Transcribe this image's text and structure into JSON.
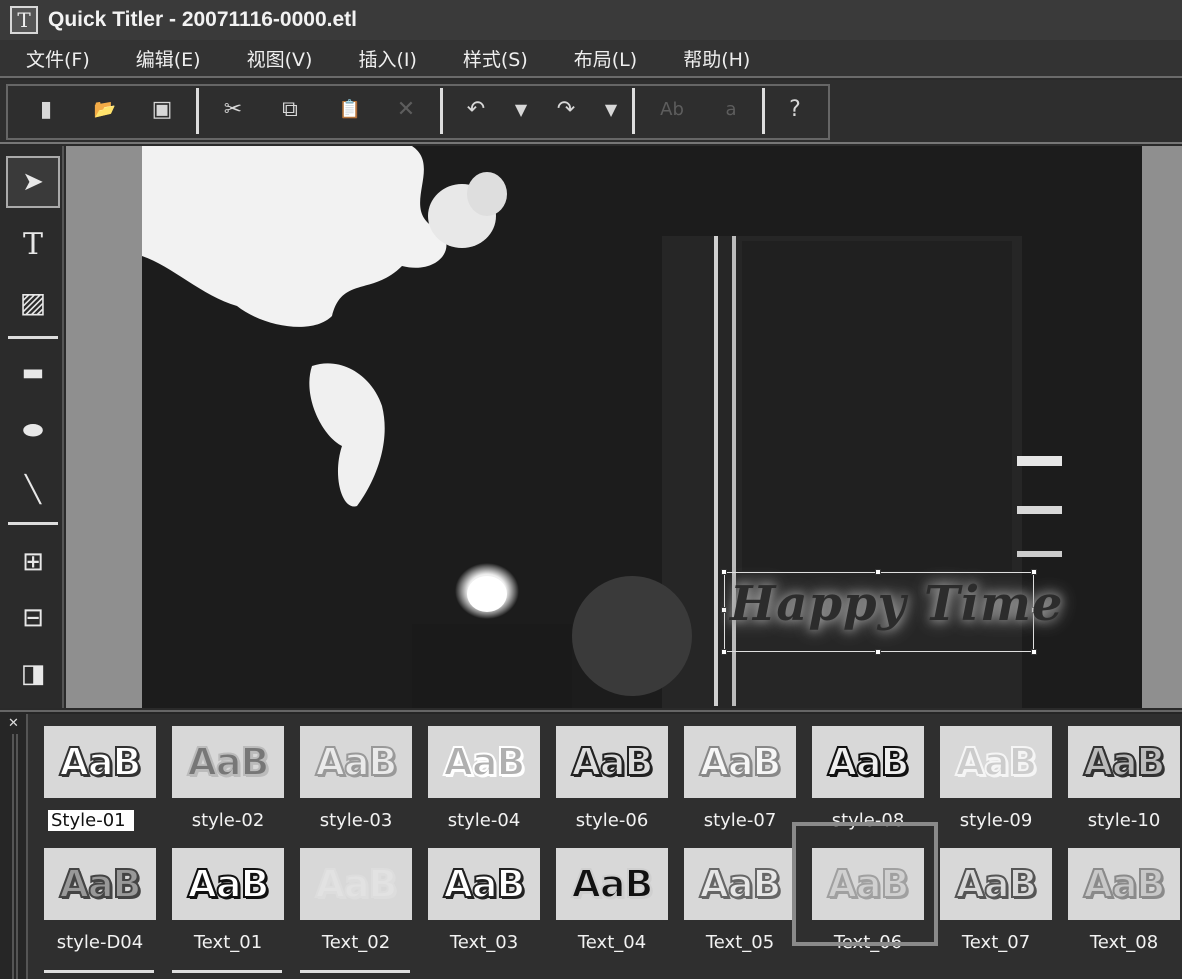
{
  "window": {
    "app_icon": "T",
    "title": "Quick Titler - 20071116-0000.etl"
  },
  "menu": [
    {
      "label": "文件(F)"
    },
    {
      "label": "编辑(E)"
    },
    {
      "label": "视图(V)"
    },
    {
      "label": "插入(I)"
    },
    {
      "label": "样式(S)"
    },
    {
      "label": "布局(L)"
    },
    {
      "label": "帮助(H)"
    }
  ],
  "toolbar": {
    "buttons": [
      {
        "name": "new-file-icon",
        "glyph": "▮"
      },
      {
        "name": "open-folder-icon",
        "glyph": "📂"
      },
      {
        "name": "save-icon",
        "glyph": "▣"
      },
      {
        "name": "cut-icon",
        "glyph": "✂"
      },
      {
        "name": "copy-icon",
        "glyph": "⧉"
      },
      {
        "name": "paste-icon",
        "glyph": "📋"
      },
      {
        "name": "delete-icon",
        "glyph": "✕"
      },
      {
        "name": "undo-icon",
        "glyph": "↶"
      },
      {
        "name": "undo-dropdown-icon",
        "glyph": "▼"
      },
      {
        "name": "redo-icon",
        "glyph": "↷"
      },
      {
        "name": "redo-dropdown-icon",
        "glyph": "▼"
      },
      {
        "name": "spellcheck-icon",
        "glyph": "Ab"
      },
      {
        "name": "find-replace-icon",
        "glyph": "a"
      },
      {
        "name": "help-icon",
        "glyph": "?"
      }
    ]
  },
  "toolbox": [
    {
      "name": "select-pointer-icon",
      "glyph": "➤"
    },
    {
      "name": "text-tool-icon",
      "glyph": "T"
    },
    {
      "name": "image-tool-icon",
      "glyph": "▨"
    },
    {
      "name": "rectangle-tool-icon",
      "glyph": "▬"
    },
    {
      "name": "ellipse-tool-icon",
      "glyph": "⬬"
    },
    {
      "name": "line-tool-icon",
      "glyph": "╲"
    },
    {
      "name": "align-icon",
      "glyph": "⊞"
    },
    {
      "name": "center-align-icon",
      "glyph": "⊟"
    },
    {
      "name": "shadow-icon",
      "glyph": "◨"
    }
  ],
  "canvas": {
    "title_text": "Happy Time"
  },
  "styles": {
    "row1": [
      {
        "label": "Style-01",
        "swatch": "AaB",
        "fill": "#ffffff",
        "stroke": "#333333"
      },
      {
        "label": "style-02",
        "swatch": "AaB",
        "fill": "#777777",
        "stroke": "#bbbbbb"
      },
      {
        "label": "style-03",
        "swatch": "AaB",
        "fill": "#eaeaea",
        "stroke": "#999999"
      },
      {
        "label": "style-04",
        "swatch": "AaB",
        "fill": "#b0b0b0",
        "stroke": "#ffffff"
      },
      {
        "label": "style-06",
        "swatch": "AaB",
        "fill": "#dddddd",
        "stroke": "#222222"
      },
      {
        "label": "style-07",
        "swatch": "AaB",
        "fill": "#f6f6f6",
        "stroke": "#888888"
      },
      {
        "label": "style-08",
        "swatch": "AaB",
        "fill": "#eeeeee",
        "stroke": "#111111"
      },
      {
        "label": "style-09",
        "swatch": "AaB",
        "fill": "#cccccc",
        "stroke": "#f5f5f5"
      },
      {
        "label": "style-10",
        "swatch": "AaB",
        "fill": "#bbbbbb",
        "stroke": "#333333"
      }
    ],
    "row2": [
      {
        "label": "style-D04",
        "swatch": "AaB",
        "fill": "#999999",
        "stroke": "#444444"
      },
      {
        "label": "Text_01",
        "swatch": "AaB",
        "fill": "#ffffff",
        "stroke": "#111111"
      },
      {
        "label": "Text_02",
        "swatch": "AaB",
        "fill": "#e2e2e2",
        "stroke": "#dddddd"
      },
      {
        "label": "Text_03",
        "swatch": "AaB",
        "fill": "#ffffff",
        "stroke": "#222222"
      },
      {
        "label": "Text_04",
        "swatch": "AaB",
        "fill": "#111111",
        "stroke": "#cfcfcf"
      },
      {
        "label": "Text_05",
        "swatch": "AaB",
        "fill": "#e6e6e6",
        "stroke": "#666666"
      },
      {
        "label": "Text_06",
        "swatch": "AaB",
        "fill": "#d0d0d0",
        "stroke": "#a0a0a0"
      },
      {
        "label": "Text_07",
        "swatch": "AaB",
        "fill": "#d8d8d8",
        "stroke": "#555555"
      },
      {
        "label": "Text_08",
        "swatch": "AaB",
        "fill": "#c8c8c8",
        "stroke": "#8a8a8a"
      }
    ]
  }
}
